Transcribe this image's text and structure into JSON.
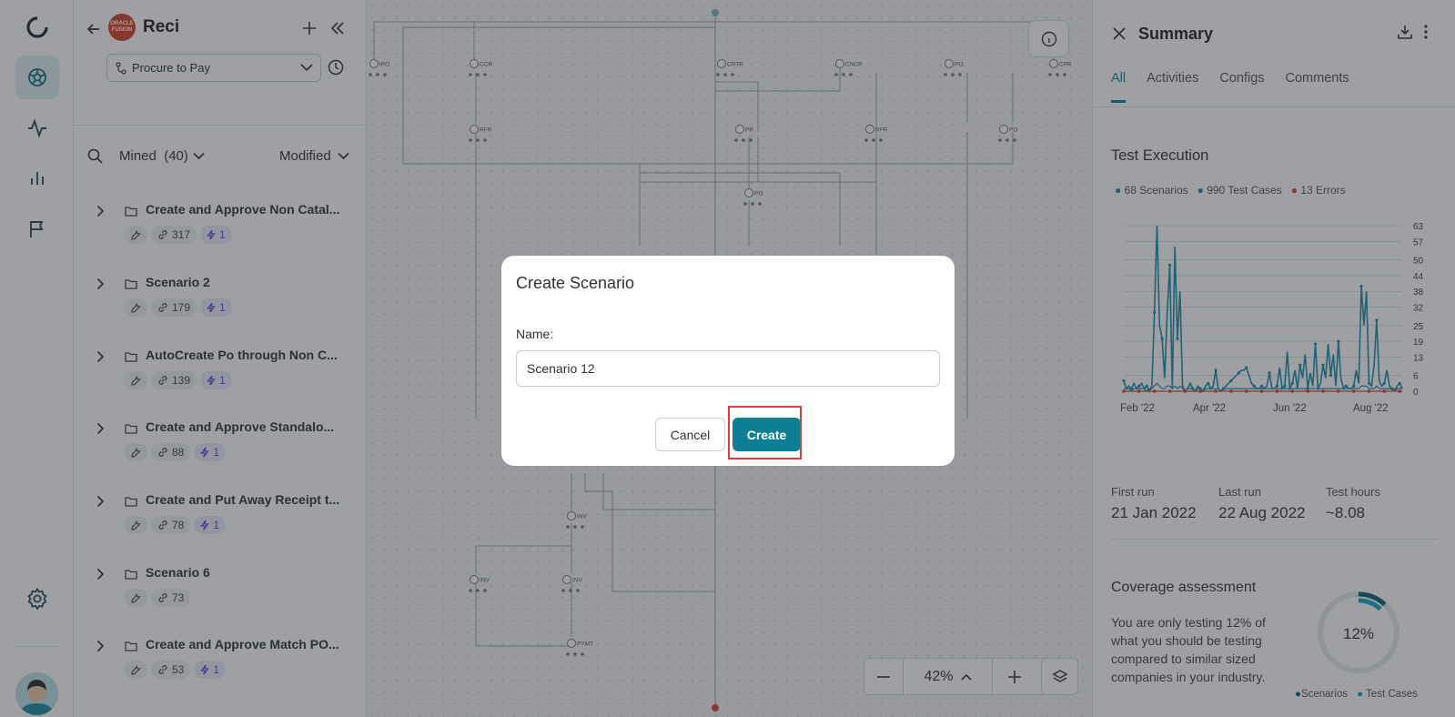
{
  "rail": {
    "items": [
      {
        "icon": "process-icon",
        "active": true
      },
      {
        "icon": "activity-icon",
        "active": false
      },
      {
        "icon": "bar-chart-icon",
        "active": false
      },
      {
        "icon": "flag-icon",
        "active": false
      }
    ],
    "bottom_icons": [
      "settings-icon",
      "user-avatar"
    ]
  },
  "left_panel": {
    "logo_text": [
      "ORACLE",
      "FUSION"
    ],
    "project_name": "Reci",
    "process_select": "Procure to Pay",
    "filter": {
      "label": "Mined",
      "count": "(40)",
      "sort": "Modified"
    },
    "scenarios": [
      {
        "title": "Create and Approve Non Catal...",
        "links": "317",
        "flash": "1"
      },
      {
        "title": "Scenario 2",
        "links": "179",
        "flash": "1"
      },
      {
        "title": "AutoCreate Po through Non C...",
        "links": "139",
        "flash": "1"
      },
      {
        "title": "Create and Approve Standalo...",
        "links": "88",
        "flash": "1"
      },
      {
        "title": "Create and Put Away Receipt t...",
        "links": "78",
        "flash": "1"
      },
      {
        "title": "Scenario 6",
        "links": "73",
        "flash": null
      },
      {
        "title": "Create and Approve Match PO...",
        "links": "53",
        "flash": "1"
      }
    ]
  },
  "canvas": {
    "zoom": "42%",
    "node_labels": [
      "IPO",
      "CCR",
      "CRTR",
      "CNCR",
      "PO",
      "CPR",
      "RFR",
      "PR",
      "RFR",
      "PO",
      "PO",
      "INV",
      "INV",
      "INV",
      "PYMT"
    ]
  },
  "summary": {
    "title": "Summary",
    "tabs": [
      {
        "label": "All",
        "active": true
      },
      {
        "label": "Activities",
        "active": false
      },
      {
        "label": "Configs",
        "active": false
      },
      {
        "label": "Comments",
        "active": false
      }
    ],
    "test_execution": {
      "title": "Test Execution",
      "legend": [
        {
          "label": "68 Scenarios",
          "color": "#1a8fa8"
        },
        {
          "label": "990 Test Cases",
          "color": "#1a8fa8"
        },
        {
          "label": "13 Errors",
          "color": "#d9412b"
        }
      ]
    },
    "stats": [
      {
        "label": "First run",
        "value": "21 Jan 2022"
      },
      {
        "label": "Last run",
        "value": "22 Aug 2022"
      },
      {
        "label": "Test hours",
        "value": "~8.08"
      }
    ],
    "coverage": {
      "title": "Coverage assessment",
      "text": "You are only testing 12% of what you should be testing compared to similar sized companies in your industry.",
      "percent_label": "12%",
      "percent": 12,
      "legend": [
        "Scenarios",
        "Test Cases"
      ]
    }
  },
  "modal": {
    "title": "Create Scenario",
    "name_label": "Name:",
    "name_value": "Scenario 12",
    "cancel": "Cancel",
    "create": "Create"
  },
  "chart_data": {
    "type": "line",
    "title": "",
    "x_tick_labels": [
      "Feb '22",
      "Apr '22",
      "Jun '22",
      "Aug '22"
    ],
    "y_tick_labels": [
      "63",
      "57",
      "50",
      "44",
      "38",
      "32",
      "25",
      "19",
      "13",
      "6",
      "0"
    ],
    "ylim": [
      0,
      63
    ],
    "series": [
      {
        "name": "990 Test Cases",
        "color": "#1a8fa8",
        "values": [
          4,
          1,
          2,
          1,
          3,
          1,
          2,
          3,
          1,
          2,
          0,
          2,
          30,
          63,
          25,
          20,
          5,
          30,
          48,
          1,
          55,
          20,
          38,
          2,
          0,
          1,
          3,
          1,
          0,
          2,
          1,
          0,
          2,
          3,
          1,
          2,
          8,
          1,
          0,
          1,
          2,
          3,
          4,
          5,
          6,
          7,
          8,
          8,
          9,
          6,
          3,
          2,
          1,
          1,
          2,
          1,
          2,
          7,
          1,
          1,
          2,
          9,
          1,
          2,
          15,
          1,
          3,
          8,
          1,
          10,
          5,
          14,
          1,
          7,
          2,
          18,
          1,
          3,
          10,
          5,
          18,
          6,
          14,
          2,
          19,
          5,
          1,
          2,
          1,
          1,
          2,
          8,
          3,
          40,
          25,
          38,
          3,
          2,
          10,
          27,
          4,
          2,
          3,
          8,
          2,
          1,
          0,
          2,
          3,
          1
        ]
      },
      {
        "name": "68 Scenarios",
        "color": "#1a8fa8",
        "values": [
          1,
          1,
          1,
          0,
          1,
          1,
          1,
          1,
          1,
          0,
          1,
          1,
          2,
          3,
          2,
          1,
          1,
          2,
          2,
          1,
          2,
          1,
          2,
          1,
          0,
          1,
          1,
          1,
          0,
          1,
          1,
          0,
          1,
          1,
          1,
          1,
          1,
          1,
          0,
          1,
          1,
          1,
          1,
          1,
          1,
          1,
          1,
          1,
          1,
          1,
          1,
          1,
          1,
          1,
          1,
          1,
          1,
          1,
          1,
          1,
          1,
          1,
          1,
          1,
          1,
          1,
          1,
          1,
          1,
          1,
          1,
          1,
          1,
          1,
          1,
          1,
          1,
          1,
          1,
          1,
          1,
          1,
          1,
          1,
          1,
          1,
          1,
          1,
          1,
          1,
          1,
          1,
          1,
          2,
          2,
          2,
          1,
          1,
          1,
          2,
          1,
          1,
          1,
          1,
          1,
          1,
          0,
          1,
          1,
          1
        ]
      },
      {
        "name": "13 Errors",
        "color": "#d9412b",
        "values": [
          0,
          0,
          0,
          0,
          0,
          0,
          0,
          0,
          0,
          0,
          0,
          0,
          0,
          0,
          0,
          0,
          0,
          0,
          0,
          0,
          0,
          0,
          0,
          0,
          0,
          0,
          0,
          0,
          0,
          0,
          0,
          0,
          0,
          0,
          0,
          0,
          0,
          0,
          0,
          0,
          0,
          0,
          0,
          0,
          0,
          0,
          0,
          0,
          0,
          0,
          0,
          0,
          0,
          0,
          0,
          0,
          0,
          0,
          0,
          0,
          0,
          0,
          0,
          0,
          0,
          0,
          0,
          0,
          0,
          0,
          0,
          0,
          0,
          0,
          0,
          0,
          0,
          0,
          0,
          0,
          0,
          0,
          0,
          0,
          0,
          0,
          0,
          0,
          0,
          0,
          0,
          0,
          0,
          0,
          0,
          0,
          0,
          0,
          0,
          0,
          0,
          0,
          0,
          0,
          0,
          0,
          1,
          0,
          0,
          0
        ]
      }
    ],
    "grid": true,
    "legend_position": "top-left"
  }
}
